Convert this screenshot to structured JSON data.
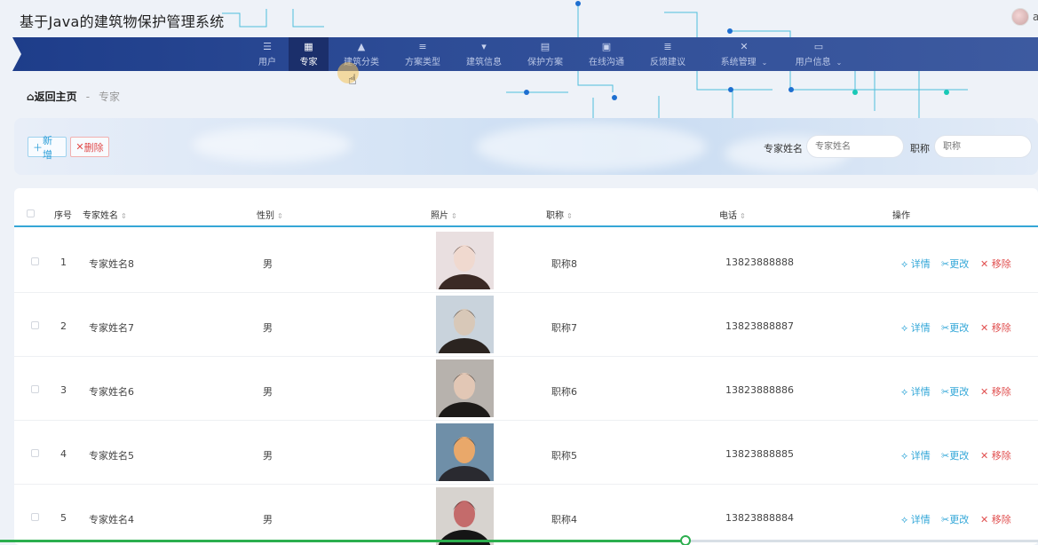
{
  "app": {
    "title": "基于Java的建筑物保护管理系统",
    "user_initial": "a"
  },
  "nav": {
    "items": [
      {
        "label": "用户",
        "icon": "list-icon"
      },
      {
        "label": "专家",
        "icon": "grid-icon",
        "active": true
      },
      {
        "label": "建筑分类",
        "icon": "person-icon"
      },
      {
        "label": "方案类型",
        "icon": "sliders-icon"
      },
      {
        "label": "建筑信息",
        "icon": "flag-icon"
      },
      {
        "label": "保护方案",
        "icon": "clipboard-icon"
      },
      {
        "label": "在线沟通",
        "icon": "medkit-icon"
      },
      {
        "label": "反馈建议",
        "icon": "menu-icon"
      },
      {
        "label": "系统管理",
        "icon": "ticket-icon",
        "has_caret": true
      },
      {
        "label": "用户信息",
        "icon": "window-icon",
        "has_caret": true
      }
    ]
  },
  "breadcrumb": {
    "home": "返回主页",
    "separator": "-",
    "current": "专家"
  },
  "toolbar": {
    "add_label": "新增",
    "delete_label": "删除",
    "search_name_label": "专家姓名",
    "search_name_placeholder": "专家姓名",
    "search_title_label": "职称",
    "search_title_placeholder": "职称"
  },
  "table": {
    "headers": {
      "index": "序号",
      "name": "专家姓名",
      "gender": "性别",
      "photo": "照片",
      "title": "职称",
      "phone": "电话",
      "actions": "操作"
    },
    "actions": {
      "detail": "详情",
      "edit": "更改",
      "remove": "移除"
    },
    "rows": [
      {
        "index": "1",
        "name": "专家姓名8",
        "gender": "男",
        "title": "职称8",
        "phone": "13823888888",
        "photo_colors": [
          "#e9dfe0",
          "#3b2a25",
          "#f0d9cf"
        ]
      },
      {
        "index": "2",
        "name": "专家姓名7",
        "gender": "男",
        "title": "职称7",
        "phone": "13823888887",
        "photo_colors": [
          "#c9d3dc",
          "#2b2420",
          "#d8c8b8"
        ]
      },
      {
        "index": "3",
        "name": "专家姓名6",
        "gender": "男",
        "title": "职称6",
        "phone": "13823888886",
        "photo_colors": [
          "#b7b2ad",
          "#1c1a18",
          "#e2c7b5"
        ]
      },
      {
        "index": "4",
        "name": "专家姓名5",
        "gender": "男",
        "title": "职称5",
        "phone": "13823888885",
        "photo_colors": [
          "#6f8fa8",
          "#2a2a30",
          "#e9a86a"
        ]
      },
      {
        "index": "5",
        "name": "专家姓名4",
        "gender": "男",
        "title": "职称4",
        "phone": "13823888884",
        "photo_colors": [
          "#d7d3cf",
          "#151515",
          "#c46b6b"
        ]
      }
    ]
  },
  "video_progress": {
    "fraction": 0.66
  },
  "colors": {
    "nav": "#2d4c96",
    "accent": "#35a7d6",
    "danger": "#e05050",
    "progress": "#2cae4e"
  }
}
